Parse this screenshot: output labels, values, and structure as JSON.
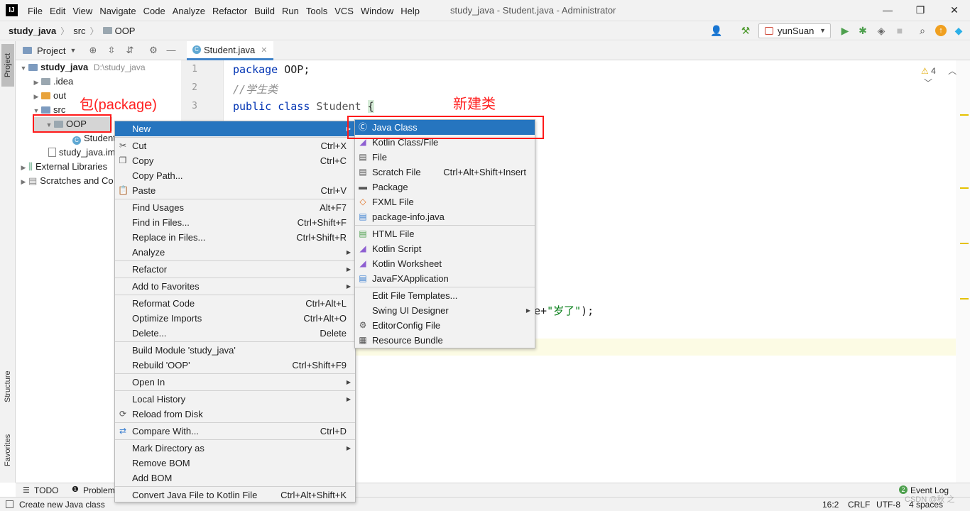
{
  "app": {
    "logo": "IJ",
    "menu": [
      "File",
      "Edit",
      "View",
      "Navigate",
      "Code",
      "Analyze",
      "Refactor",
      "Build",
      "Run",
      "Tools",
      "VCS",
      "Window",
      "Help"
    ],
    "window_title": "study_java - Student.java - Administrator",
    "controls": {
      "minimize": "—",
      "maximize": "❐",
      "close": "✕"
    }
  },
  "navbar": {
    "crumbs": [
      "study_java",
      "src",
      "OOP"
    ],
    "run_config": "yunSuan"
  },
  "tool_strip": {
    "project": "Project",
    "structure": "Structure",
    "favorites": "Favorites"
  },
  "project_panel": {
    "title": "Project",
    "tree": [
      {
        "label": "study_java",
        "extra": "D:\\study_java"
      },
      {
        "label": ".idea"
      },
      {
        "label": "out"
      },
      {
        "label": "src"
      },
      {
        "label": "OOP"
      },
      {
        "label": "Student"
      },
      {
        "label": "study_java.iml"
      },
      {
        "label": "External Libraries"
      },
      {
        "label": "Scratches and Co"
      }
    ]
  },
  "editor": {
    "tab": "Student.java",
    "line_numbers": [
      "1",
      "2",
      "3"
    ],
    "lines": {
      "l1_kw": "package",
      "l1_rest": " OOP;",
      "l2": "//学生类",
      "l3_kw1": "public",
      "l3_kw2": "class",
      "l3_name": " Student ",
      "l3_brace": "{",
      "partial_a": "e+",
      "partial_str": "\"岁了\"",
      "partial_b": ");"
    },
    "warnings": "4"
  },
  "context_menu": {
    "items": [
      {
        "label": "New"
      },
      {
        "label": "Cut",
        "shortcut": "Ctrl+X"
      },
      {
        "label": "Copy",
        "shortcut": "Ctrl+C"
      },
      {
        "label": "Copy Path..."
      },
      {
        "label": "Paste",
        "shortcut": "Ctrl+V"
      },
      {
        "label": "Find Usages",
        "shortcut": "Alt+F7"
      },
      {
        "label": "Find in Files...",
        "shortcut": "Ctrl+Shift+F"
      },
      {
        "label": "Replace in Files...",
        "shortcut": "Ctrl+Shift+R"
      },
      {
        "label": "Analyze"
      },
      {
        "label": "Refactor"
      },
      {
        "label": "Add to Favorites"
      },
      {
        "label": "Reformat Code",
        "shortcut": "Ctrl+Alt+L"
      },
      {
        "label": "Optimize Imports",
        "shortcut": "Ctrl+Alt+O"
      },
      {
        "label": "Delete...",
        "shortcut": "Delete"
      },
      {
        "label": "Build Module 'study_java'"
      },
      {
        "label": "Rebuild 'OOP'",
        "shortcut": "Ctrl+Shift+F9"
      },
      {
        "label": "Open In"
      },
      {
        "label": "Local History"
      },
      {
        "label": "Reload from Disk"
      },
      {
        "label": "Compare With...",
        "shortcut": "Ctrl+D"
      },
      {
        "label": "Mark Directory as"
      },
      {
        "label": "Remove BOM"
      },
      {
        "label": "Add BOM"
      },
      {
        "label": "Convert Java File to Kotlin File",
        "shortcut": "Ctrl+Alt+Shift+K"
      }
    ]
  },
  "submenu": {
    "items": [
      {
        "label": "Java Class"
      },
      {
        "label": "Kotlin Class/File"
      },
      {
        "label": "File"
      },
      {
        "label": "Scratch File",
        "shortcut": "Ctrl+Alt+Shift+Insert"
      },
      {
        "label": "Package"
      },
      {
        "label": "FXML File"
      },
      {
        "label": "package-info.java"
      },
      {
        "label": "HTML File"
      },
      {
        "label": "Kotlin Script"
      },
      {
        "label": "Kotlin Worksheet"
      },
      {
        "label": "JavaFXApplication"
      },
      {
        "label": "Edit File Templates..."
      },
      {
        "label": "Swing UI Designer"
      },
      {
        "label": "EditorConfig File"
      },
      {
        "label": "Resource Bundle"
      }
    ]
  },
  "annotations": {
    "package_label": "包(package)",
    "new_class_label": "新建类"
  },
  "bottom_toolbar": {
    "todo": "TODO",
    "problems": "Problem",
    "event_log": "Event Log",
    "event_count": "2"
  },
  "statusbar": {
    "message": "Create new Java class",
    "position": "16:2",
    "line_sep": "CRLF",
    "encoding": "UTF-8",
    "indent": "4 spaces",
    "watermark": "CSDN @秋 之"
  },
  "colors": {
    "accent": "#2675bf",
    "annotation": "#ff1a1a",
    "keyword": "#0033b3"
  }
}
